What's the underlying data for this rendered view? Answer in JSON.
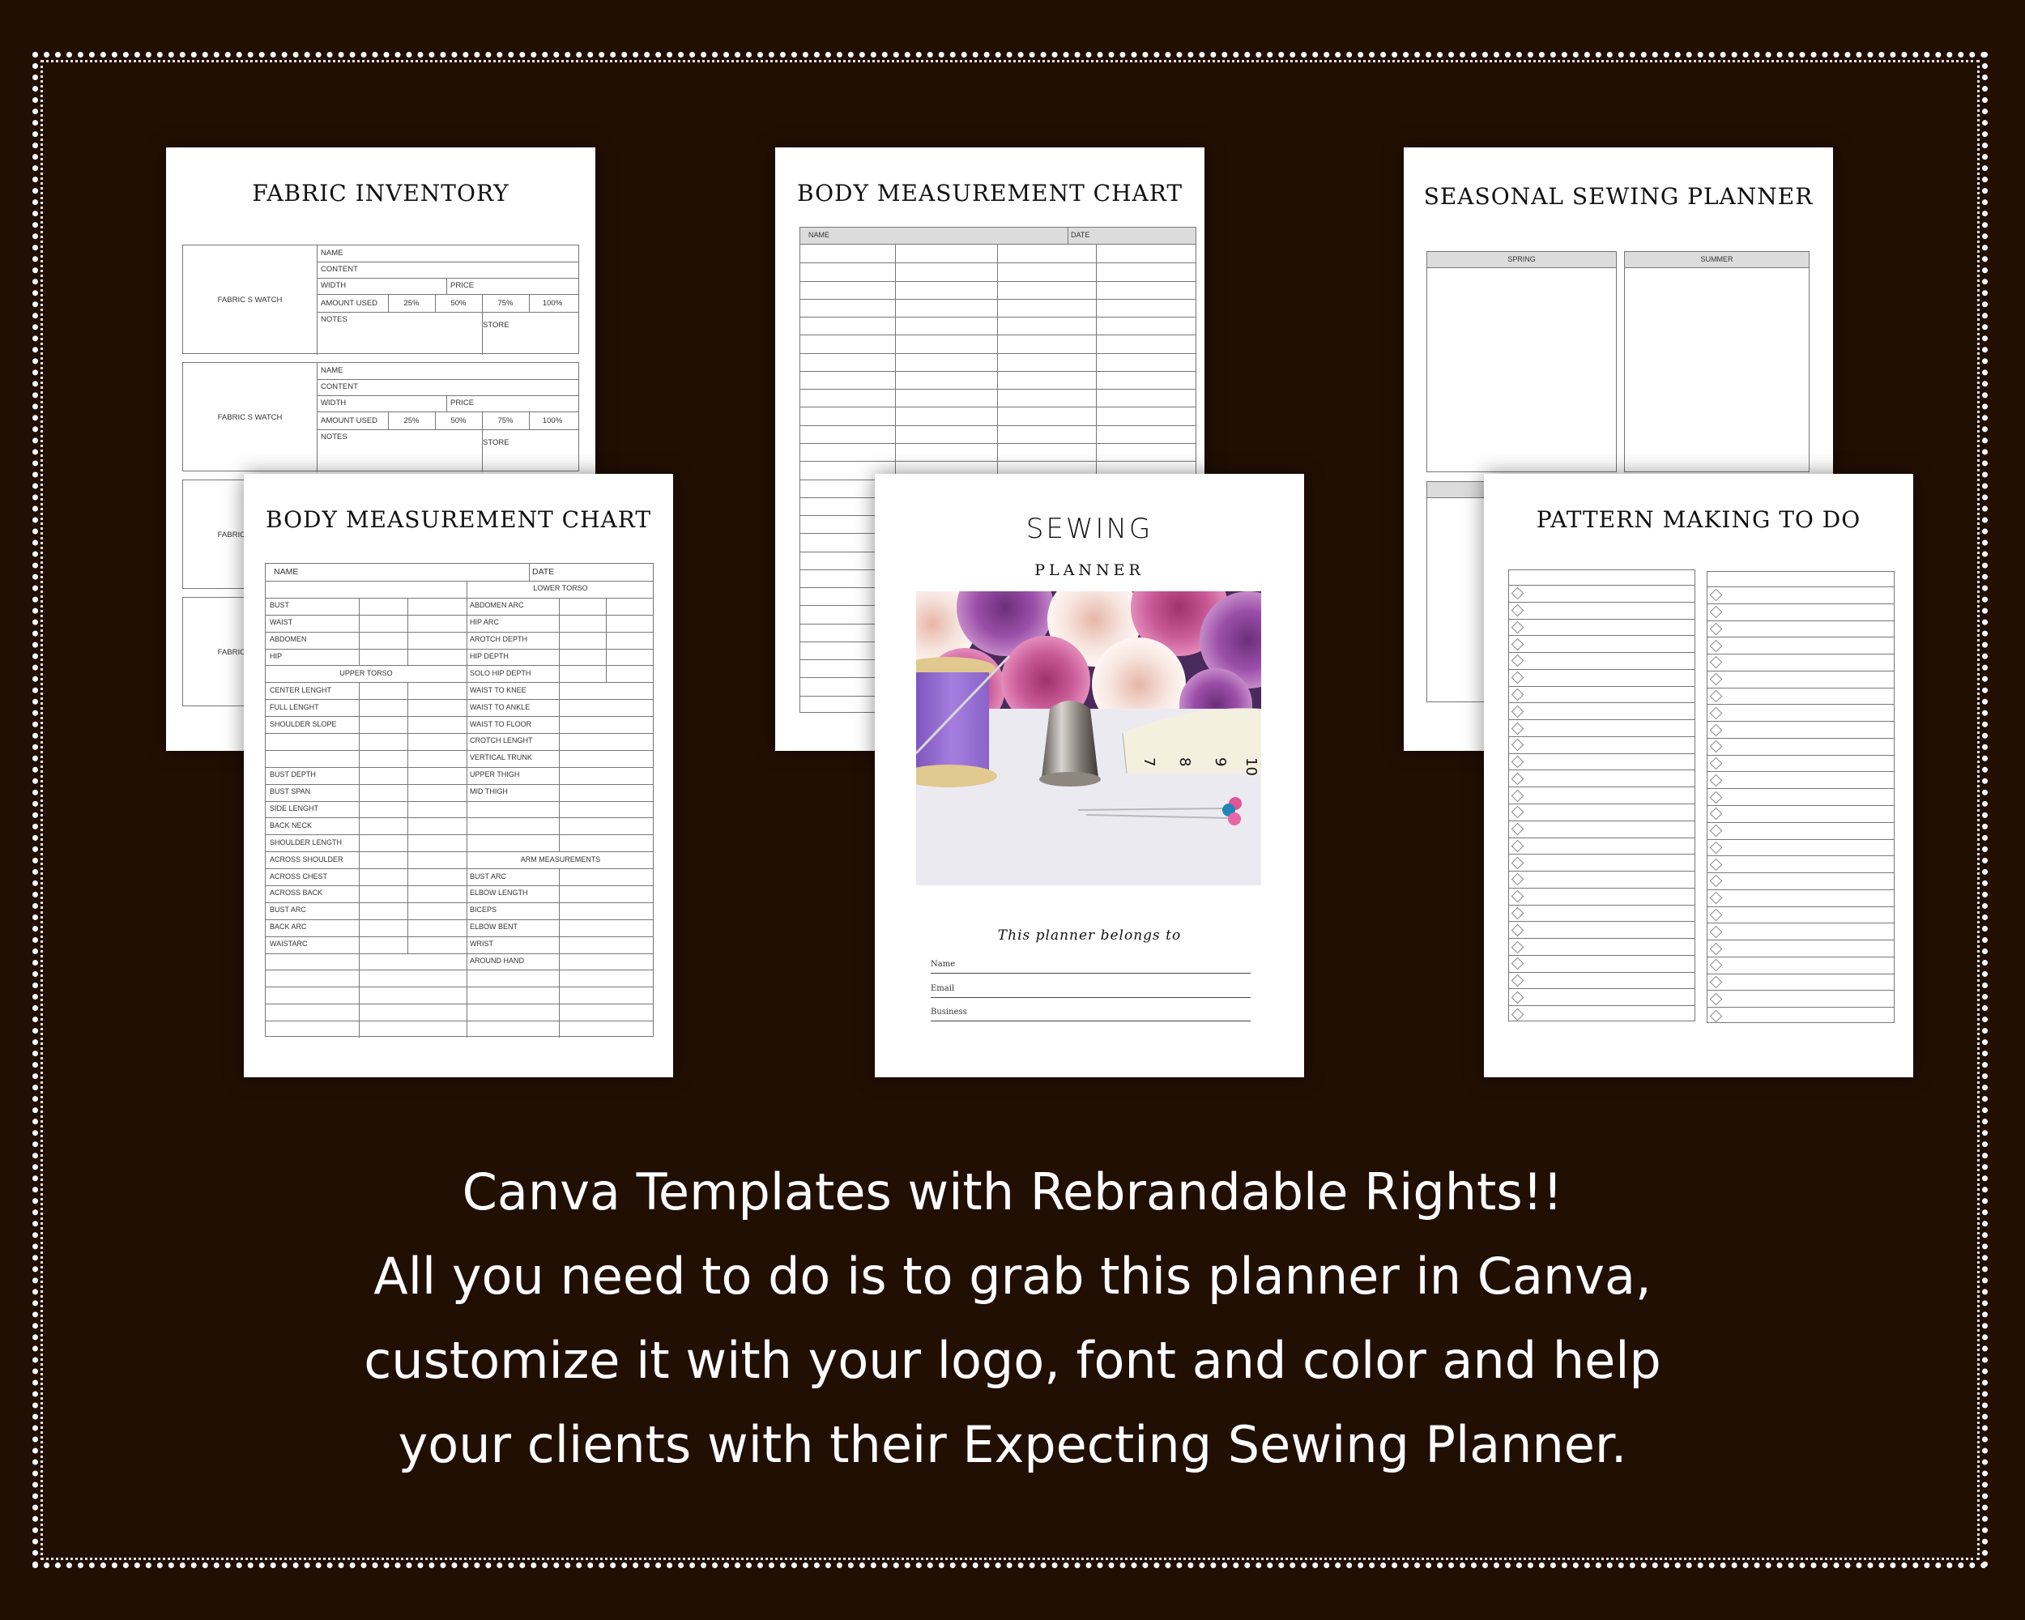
{
  "colors": {
    "background": "#220f04",
    "page": "#ffffff",
    "grid_line": "#777777",
    "header_fill": "#dcdcdc",
    "spool_purple": "#9b6fd0"
  },
  "fabric_inventory": {
    "title": "FABRIC INVENTORY",
    "swatch_label": "FABRIC S WATCH",
    "fields": {
      "name": "NAME",
      "content": "CONTENT",
      "width": "WIDTH",
      "price": "PRICE",
      "amount_used": "AMOUNT USED",
      "notes": "NOTES",
      "store": "STORE"
    },
    "percentages": [
      "25%",
      "50%",
      "75%",
      "100%"
    ],
    "partial_label": "FABRI"
  },
  "body_chart_blank": {
    "title": "BODY MEASUREMENT CHART",
    "name_label": "NAME",
    "date_label": "DATE"
  },
  "body_chart_filled": {
    "title": "BODY MEASUREMENT CHART",
    "name_label": "NAME",
    "date_label": "DATE",
    "left_rows": [
      "",
      "BUST",
      "WAIST",
      "ABDOMEN",
      "HIP",
      "UPPER TORSO",
      "CENTER LENGHT",
      "FULL LENGHT",
      "SHOULDER SLOPE",
      "",
      "",
      "BUST DEPTH",
      "BUST SPAN",
      "SIDE LENGHT",
      "BACK NECK",
      "SHOULDER LENGTH",
      "ACROSS SHOULDER",
      "ACROSS CHEST",
      "ACROSS BACK",
      "BUST ARC",
      "BACK ARC",
      "WAISTARC",
      "",
      "",
      "",
      "",
      ""
    ],
    "right_rows": [
      "LOWER TORSO",
      "ABDOMEN ARC",
      "HIP ARC",
      "AROTCH  DEPTH",
      "HIP DEPTH",
      "SOLO HIP DEPTH",
      "WAIST TO KNEE",
      "WAIST TO ANKLE",
      "WAIST TO FLOOR",
      "CROTCH LENGHT",
      "VERTICAL TRUNK",
      "UPPER THIGH",
      "MID THIGH",
      "",
      "",
      "",
      "ARM MEASUREMENTS",
      "BUST ARC",
      "ELBOW LENGTH",
      "BICEPS",
      "ELBOW BENT",
      "WRIST",
      "AROUND HAND",
      "",
      "",
      "",
      ""
    ]
  },
  "cover": {
    "title": "SEWING",
    "subtitle": "PLANNER",
    "belongs_to": "This planner belongs to",
    "fields": [
      "Name",
      "Email",
      "Business"
    ],
    "image_alt": "purple thread spool, thimble, tape measure and pins in front of roses",
    "tape_numbers": [
      "7",
      "8",
      "9",
      "10"
    ]
  },
  "seasonal": {
    "title": "SEASONAL SEWING PLANNER",
    "seasons": [
      "SPRING",
      "SUMMER"
    ]
  },
  "pattern_todo": {
    "title": "PATTERN MAKING TO DO",
    "rows_per_column": 26
  },
  "caption": {
    "lines": [
      "Canva Templates with Rebrandable Rights!!",
      "All you need to do is to grab this planner in Canva,",
      "customize it with your logo, font and color and help",
      "your clients with their Expecting Sewing Planner."
    ]
  }
}
